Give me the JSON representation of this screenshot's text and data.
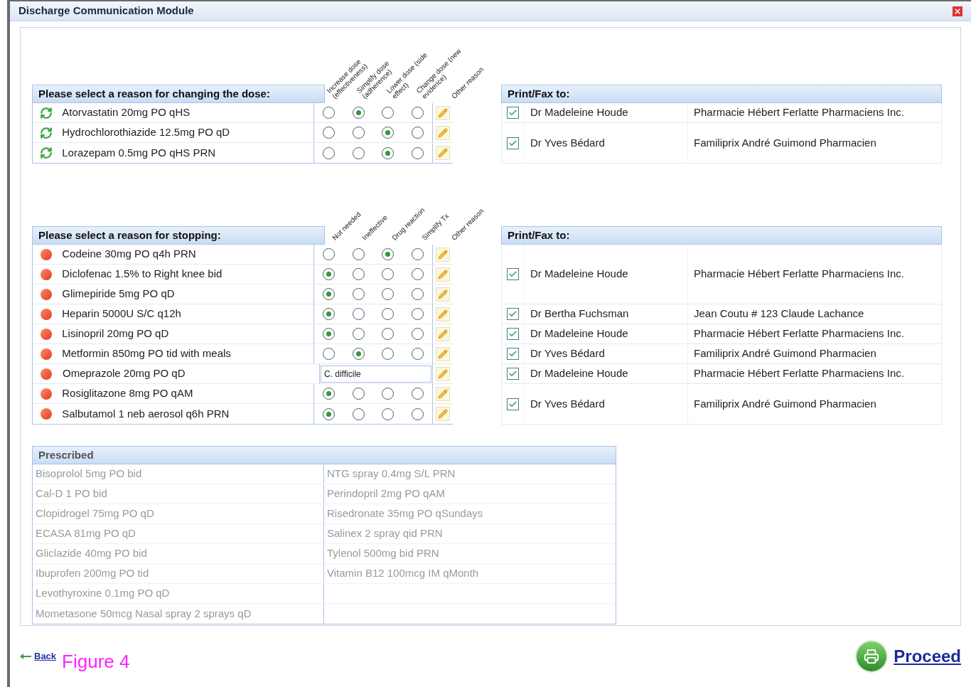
{
  "window": {
    "title": "Discharge Communication Module"
  },
  "change_dose": {
    "title": "Please select a reason for changing the dose:",
    "columns": [
      "Increase dose (effectiveness)",
      "Simplify dose (adherence)",
      "Lower dose (side effect)",
      "Change dose (new evidence)",
      "Other reason"
    ],
    "rows": [
      {
        "drug": "Atorvastatin 20mg PO qHS",
        "kind": "radios",
        "options": [
          {
            "selected": false
          },
          {
            "selected": true
          },
          {
            "selected": false
          },
          {
            "selected": false
          }
        ]
      },
      {
        "drug": "Hydrochlorothiazide 12.5mg PO qD",
        "kind": "radios",
        "options": [
          {
            "selected": false
          },
          {
            "selected": false
          },
          {
            "selected": true
          },
          {
            "selected": false
          }
        ]
      },
      {
        "drug": "Lorazepam 0.5mg PO qHS PRN",
        "kind": "radios",
        "options": [
          {
            "selected": false
          },
          {
            "selected": false
          },
          {
            "selected": true
          },
          {
            "selected": false
          }
        ]
      }
    ]
  },
  "change_fax": {
    "title": "Print/Fax to:",
    "rows": [
      {
        "checked": true,
        "doctor": "Dr Madeleine Houde",
        "pharmacy": "Pharmacie Hébert Ferlatte Pharmaciens Inc."
      },
      {
        "checked": true,
        "doctor": "Dr Yves Bédard",
        "pharmacy": "Familiprix André Guimond Pharmacien"
      }
    ]
  },
  "stop": {
    "title": "Please select a reason for stopping:",
    "columns": [
      "Not needed",
      "Ineffective",
      "Drug reaction",
      "Simplify Tx",
      "Other reason"
    ],
    "rows": [
      {
        "drug": "Codeine 30mg PO q4h PRN",
        "kind": "radios",
        "options": [
          {
            "selected": false
          },
          {
            "selected": false
          },
          {
            "selected": true
          },
          {
            "selected": false
          }
        ]
      },
      {
        "drug": "Diclofenac 1.5% to Right knee bid",
        "kind": "radios",
        "options": [
          {
            "selected": true
          },
          {
            "selected": false
          },
          {
            "selected": false
          },
          {
            "selected": false
          }
        ]
      },
      {
        "drug": "Glimepiride 5mg PO qD",
        "kind": "radios",
        "options": [
          {
            "selected": true
          },
          {
            "selected": false
          },
          {
            "selected": false
          },
          {
            "selected": false
          }
        ]
      },
      {
        "drug": "Heparin 5000U S/C q12h",
        "kind": "radios",
        "options": [
          {
            "selected": true
          },
          {
            "selected": false
          },
          {
            "selected": false
          },
          {
            "selected": false
          }
        ]
      },
      {
        "drug": "Lisinopril 20mg PO qD",
        "kind": "radios",
        "options": [
          {
            "selected": true
          },
          {
            "selected": false
          },
          {
            "selected": false
          },
          {
            "selected": false
          }
        ]
      },
      {
        "drug": "Metformin 850mg PO tid with meals",
        "kind": "radios",
        "options": [
          {
            "selected": false
          },
          {
            "selected": true
          },
          {
            "selected": false
          },
          {
            "selected": false
          }
        ]
      },
      {
        "drug": "Omeprazole 20mg PO qD",
        "kind": "text",
        "value": "C. difficile"
      },
      {
        "drug": "Rosiglitazone 8mg PO qAM",
        "kind": "radios",
        "options": [
          {
            "selected": true
          },
          {
            "selected": false
          },
          {
            "selected": false
          },
          {
            "selected": false
          }
        ]
      },
      {
        "drug": "Salbutamol 1 neb aerosol q6h PRN",
        "kind": "radios",
        "options": [
          {
            "selected": true
          },
          {
            "selected": false
          },
          {
            "selected": false
          },
          {
            "selected": false
          }
        ]
      }
    ]
  },
  "stop_fax": {
    "title": "Print/Fax to:",
    "rows": [
      {
        "checked": true,
        "doctor": "Dr Madeleine Houde",
        "pharmacy": "Pharmacie Hébert Ferlatte Pharmaciens Inc."
      },
      {
        "checked": true,
        "doctor": "Dr Bertha Fuchsman",
        "pharmacy": "Jean Coutu # 123 Claude Lachance"
      },
      {
        "checked": true,
        "doctor": "Dr Madeleine Houde",
        "pharmacy": "Pharmacie Hébert Ferlatte Pharmaciens Inc."
      },
      {
        "checked": true,
        "doctor": "Dr Yves Bédard",
        "pharmacy": "Familiprix André Guimond Pharmacien"
      },
      {
        "checked": true,
        "doctor": "Dr Madeleine Houde",
        "pharmacy": "Pharmacie Hébert Ferlatte Pharmaciens Inc."
      },
      {
        "checked": true,
        "doctor": "Dr Yves Bédard",
        "pharmacy": "Familiprix André Guimond Pharmacien"
      }
    ]
  },
  "prescribed": {
    "title": "Prescribed",
    "rows": [
      [
        "Bisoprolol 5mg PO bid",
        "NTG spray 0.4mg S/L PRN"
      ],
      [
        "Cal-D 1 PO bid",
        "Perindopril 2mg PO qAM"
      ],
      [
        "Clopidrogel 75mg PO qD",
        "Risedronate 35mg PO qSundays"
      ],
      [
        "ECASA 81mg PO qD",
        "Salinex 2 spray qid PRN"
      ],
      [
        "Gliclazide 40mg PO bid",
        "Tylenol 500mg bid PRN"
      ],
      [
        "Ibuprofen 200mg PO tid",
        "Vitamin B12 100mcg IM qMonth"
      ],
      [
        "Levothyroxine 0.1mg PO qD"
      ],
      [
        "Mometasone 50mcg Nasal spray 2 sprays qD"
      ]
    ]
  },
  "footer": {
    "back": "Back",
    "proceed": "Proceed",
    "figure_label": "Figure 4"
  }
}
